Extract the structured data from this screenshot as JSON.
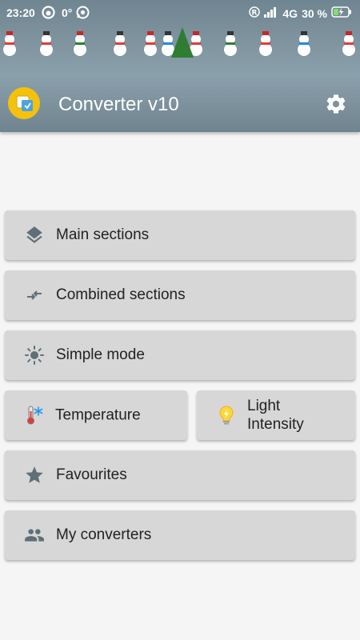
{
  "status_bar": {
    "time": "23:20",
    "temperature": "0°",
    "network": "4G",
    "battery": "30 %"
  },
  "toolbar": {
    "title": "Converter v10"
  },
  "menu": {
    "main_sections": "Main sections",
    "combined_sections": "Combined sections",
    "simple_mode": "Simple mode",
    "temperature": "Temperature",
    "light_intensity": "Light Intensity",
    "favourites": "Favourites",
    "my_converters": "My converters"
  },
  "colors": {
    "header": "#7a8f9a",
    "button": "#d7d7d7",
    "icon": "#5f6f78",
    "accent": "#f4c20d"
  }
}
